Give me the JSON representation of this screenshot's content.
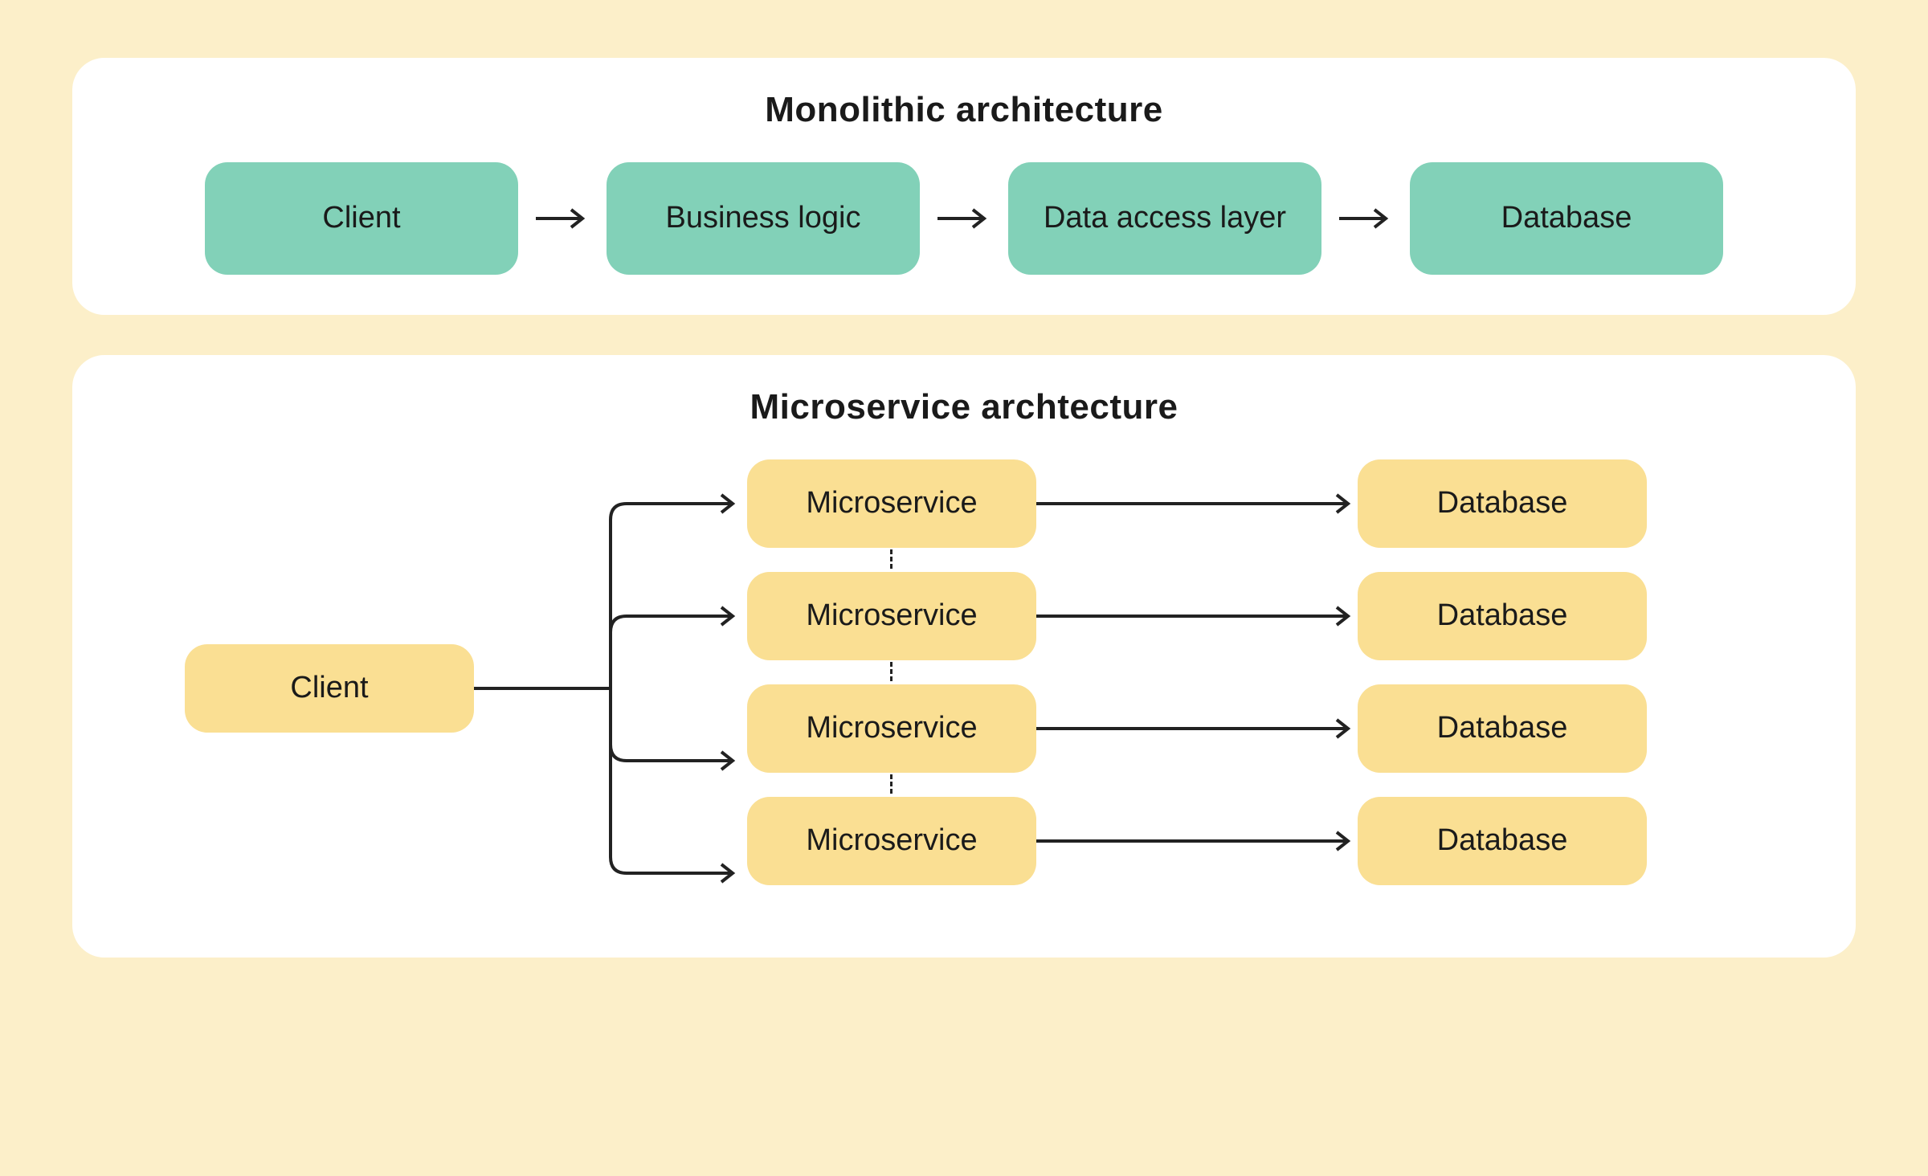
{
  "monolithic": {
    "title": "Monolithic architecture",
    "nodes": {
      "client": "Client",
      "business_logic": "Business logic",
      "data_access": "Data access layer",
      "database": "Database"
    }
  },
  "microservice": {
    "title": "Microservice archtecture",
    "client": "Client",
    "services": [
      {
        "service": "Microservice",
        "database": "Database"
      },
      {
        "service": "Microservice",
        "database": "Database"
      },
      {
        "service": "Microservice",
        "database": "Database"
      },
      {
        "service": "Microservice",
        "database": "Database"
      }
    ]
  }
}
